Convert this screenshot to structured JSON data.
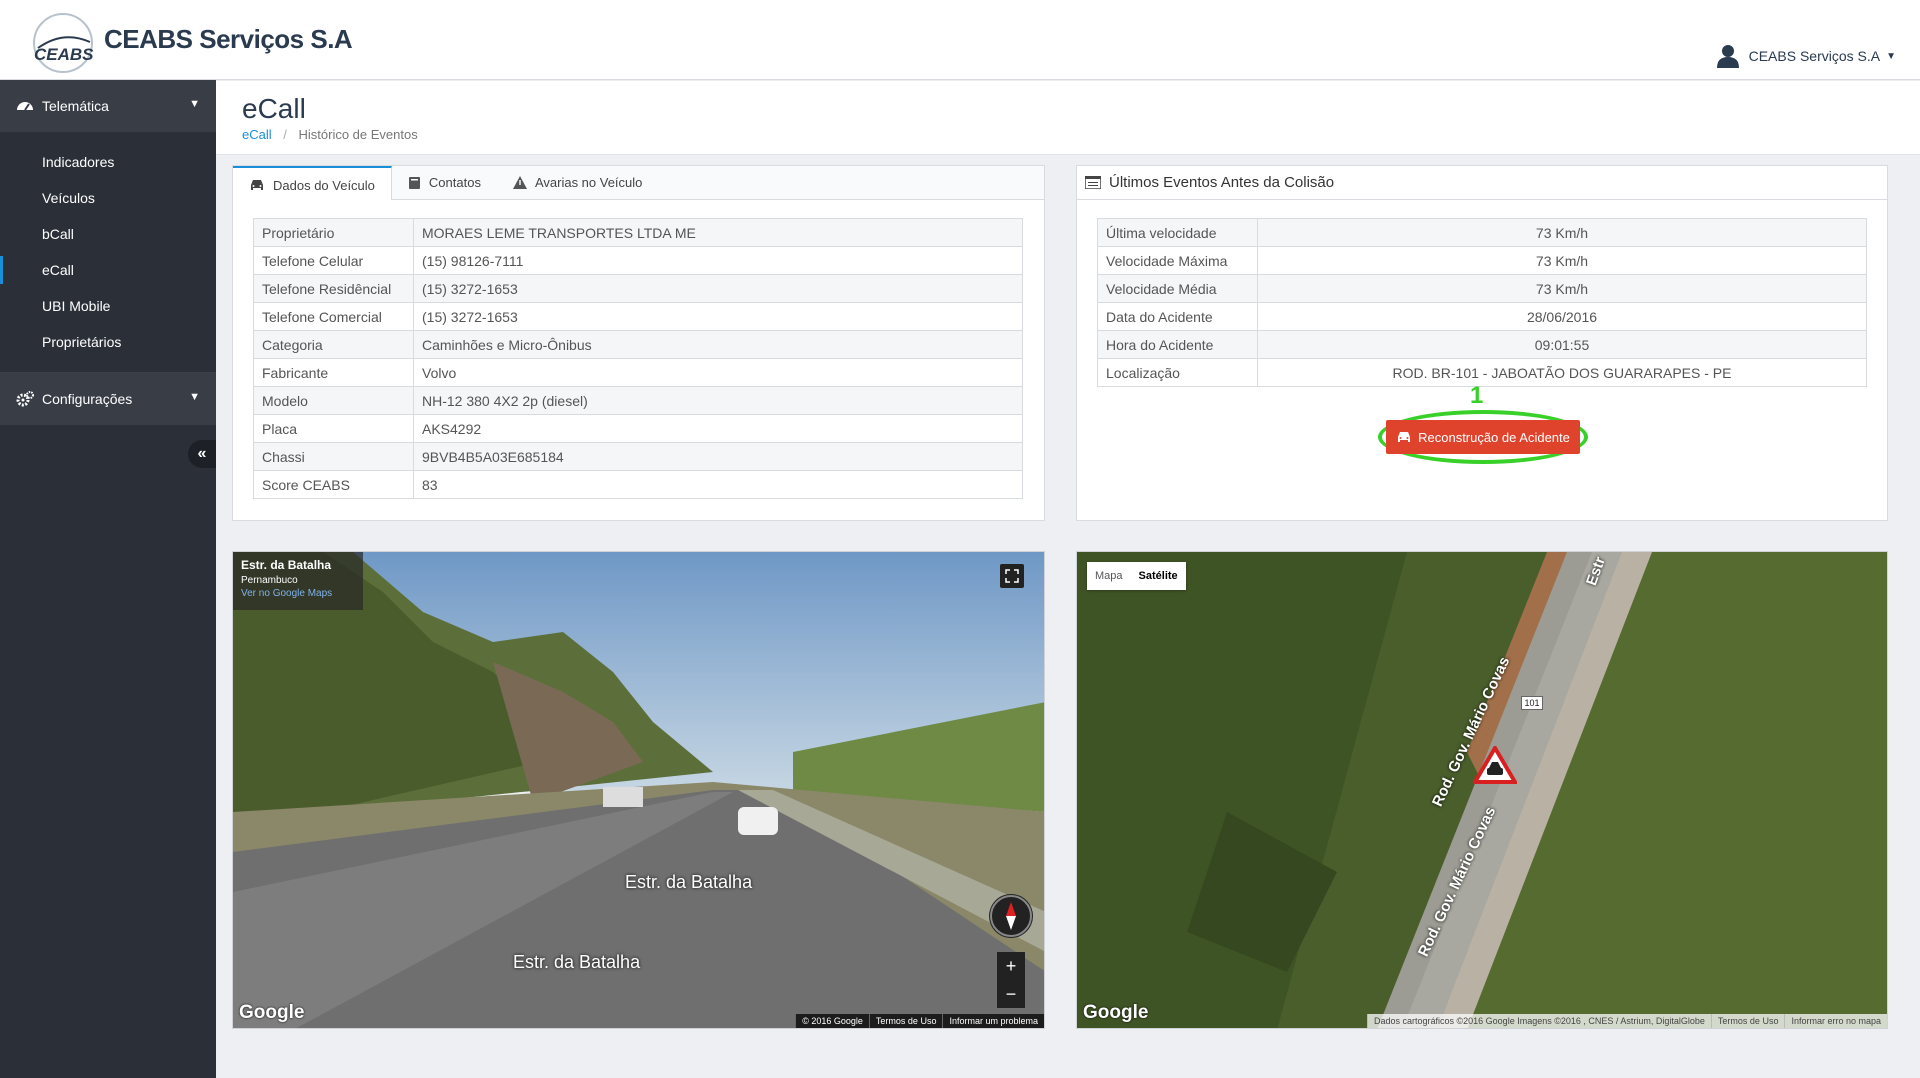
{
  "header": {
    "brand": "CEABS Serviços S.A",
    "logo_text": "CEABS",
    "user_label": "CEABS Serviços S.A"
  },
  "sidebar": {
    "group_telematica": "Telemática",
    "items": [
      "Indicadores",
      "Veículos",
      "bCall",
      "eCall",
      "UBI Mobile",
      "Proprietários"
    ],
    "active_item": "eCall",
    "group_config": "Configurações",
    "collapse_icon": "double-chevron-left-icon"
  },
  "page": {
    "title": "eCall",
    "breadcrumb": [
      "eCall",
      "Histórico de Eventos"
    ]
  },
  "vehicle_panel": {
    "tabs": [
      "Dados do Veículo",
      "Contatos",
      "Avarias no Veículo"
    ],
    "active_tab": "Dados do Veículo",
    "rows": [
      {
        "label": "Proprietário",
        "value": "MORAES LEME TRANSPORTES LTDA ME"
      },
      {
        "label": "Telefone Celular",
        "value": "(15) 98126-7111"
      },
      {
        "label": "Telefone Residêncial",
        "value": "(15) 3272-1653"
      },
      {
        "label": "Telefone Comercial",
        "value": "(15) 3272-1653"
      },
      {
        "label": "Categoria",
        "value": "Caminhões e Micro-Ônibus"
      },
      {
        "label": "Fabricante",
        "value": "Volvo"
      },
      {
        "label": "Modelo",
        "value": "NH-12 380 4X2 2p (diesel)"
      },
      {
        "label": "Placa",
        "value": "AKS4292"
      },
      {
        "label": "Chassi",
        "value": "9BVB4B5A03E685184"
      },
      {
        "label": "Score CEABS",
        "value": "83"
      }
    ]
  },
  "events_panel": {
    "title": "Últimos Eventos Antes da Colisão",
    "rows": [
      {
        "label": "Última velocidade",
        "value": "73 Km/h"
      },
      {
        "label": "Velocidade Máxima",
        "value": "73 Km/h"
      },
      {
        "label": "Velocidade Média",
        "value": "73 Km/h"
      },
      {
        "label": "Data do Acidente",
        "value": "28/06/2016"
      },
      {
        "label": "Hora do Acidente",
        "value": "09:01:55"
      },
      {
        "label": "Localização",
        "value": "ROD. BR-101 - JABOATÃO DOS GUARARAPES - PE"
      }
    ],
    "step_number": "1",
    "button_label": "Reconstrução de Acidente"
  },
  "street_view": {
    "place_title": "Estr. da Batalha",
    "place_region": "Pernambuco",
    "link": "Ver no Google Maps",
    "street_label_1": "Estr. da Batalha",
    "street_label_2": "Estr. da Batalha",
    "watermark": "Google",
    "attribution": [
      "© 2016 Google",
      "Termos de Uso",
      "Informar um problema"
    ]
  },
  "satellite_map": {
    "map_types": [
      "Mapa",
      "Satélite"
    ],
    "selected_type": "Satélite",
    "road_label_1": "Rod. Gov. Mário Covas",
    "road_label_2": "Rod. Gov. Mário Covas",
    "road_label_top": "Estr",
    "route_shield": "101",
    "watermark": "Google",
    "attribution": [
      "Dados cartográficos ©2016 Google Imagens ©2016 , CNES / Astrium, DigitalGlobe",
      "Termos de Uso",
      "Informar erro no mapa"
    ]
  },
  "colors": {
    "sidebar_bg": "#2b3038",
    "accent": "#1a8fd9",
    "button_red": "#e0432c",
    "highlight_green": "#39d129"
  }
}
